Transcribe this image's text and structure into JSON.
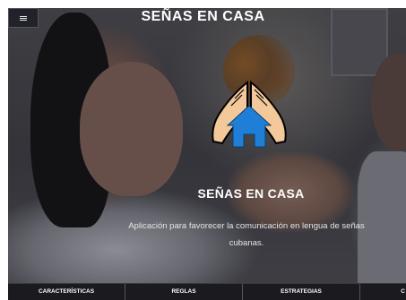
{
  "header": {
    "title": "SEÑAS EN CASA",
    "menu_icon": "hamburger-menu-icon"
  },
  "hero": {
    "title": "SEÑAS EN CASA",
    "subtitle_line1": "Aplicación para favorecer la comunicación en lengua de señas",
    "subtitle_line2": "cubanas.",
    "logo_icon": "hands-over-house-icon"
  },
  "nav": {
    "items": [
      {
        "label": "CARACTERÍSTICAS"
      },
      {
        "label": "REGLAS"
      },
      {
        "label": "ESTRATEGIAS"
      },
      {
        "label": "C"
      }
    ]
  },
  "colors": {
    "house_blue": "#1f7fd6",
    "hands_outline": "#000000",
    "hands_fill": "#f3c89b",
    "nav_bg": "#1a1a1f"
  }
}
